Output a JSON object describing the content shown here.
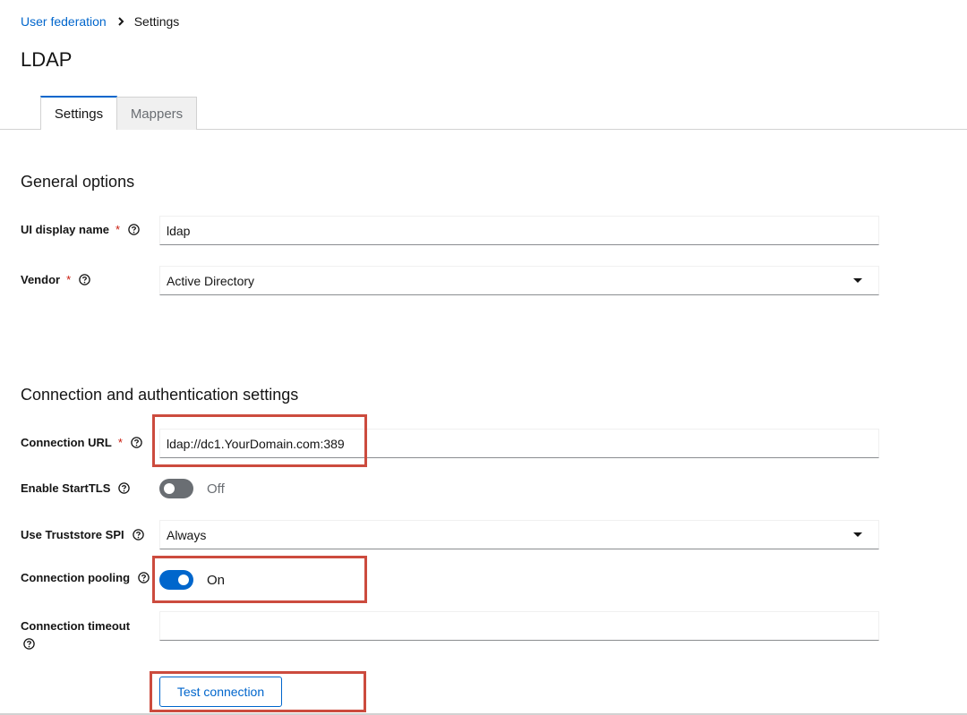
{
  "breadcrumb": {
    "parent": "User federation",
    "current": "Settings"
  },
  "page": {
    "title": "LDAP"
  },
  "tabs": [
    {
      "label": "Settings",
      "active": true
    },
    {
      "label": "Mappers",
      "active": false
    }
  ],
  "general": {
    "title": "General options",
    "ui_display_name": {
      "label": "UI display name",
      "value": "ldap"
    },
    "vendor": {
      "label": "Vendor",
      "value": "Active Directory"
    }
  },
  "connection": {
    "title": "Connection and authentication settings",
    "connection_url": {
      "label": "Connection URL",
      "value": "ldap://dc1.YourDomain.com:389"
    },
    "start_tls": {
      "label": "Enable StartTLS",
      "state": "Off"
    },
    "truststore": {
      "label": "Use Truststore SPI",
      "value": "Always"
    },
    "pooling": {
      "label": "Connection pooling",
      "state": "On"
    },
    "timeout": {
      "label": "Connection timeout",
      "value": ""
    },
    "test_button": "Test connection"
  },
  "icons": {
    "breadcrumb_separator": "chevron-right-icon",
    "help": "question-circle-icon",
    "dropdown": "caret-down-icon"
  },
  "colors": {
    "link": "#0066cc",
    "required": "#c9190b",
    "toggle_on": "#0066cc",
    "toggle_off": "#6a6e73",
    "highlight": "#cc4b3e"
  }
}
